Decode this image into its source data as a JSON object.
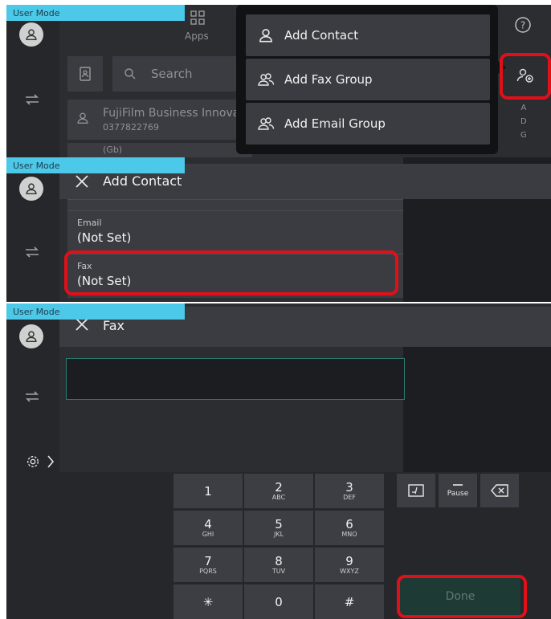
{
  "panel1": {
    "mode_label": "User Mode",
    "apps_label": "Apps",
    "search_placeholder": "Search",
    "contact_name": "FujiFilm Business Innova",
    "contact_number": "0377822769",
    "partial_row_text": "(Gb)",
    "index_letters": [
      "A",
      "D",
      "G"
    ],
    "menu": [
      {
        "icon": "person-icon",
        "label": "Add Contact"
      },
      {
        "icon": "group-icon",
        "label": "Add Fax Group"
      },
      {
        "icon": "group-icon",
        "label": "Add Email Group"
      }
    ]
  },
  "panel2": {
    "mode_label": "User Mode",
    "title": "Add Contact",
    "fields": [
      {
        "label": "Email",
        "value": "(Not Set)"
      },
      {
        "label": "Fax",
        "value": "(Not Set)"
      }
    ]
  },
  "panel3": {
    "mode_label": "User Mode",
    "title": "Fax",
    "fax_input_value": "",
    "keypad": [
      {
        "num": "1",
        "letters": ""
      },
      {
        "num": "2",
        "letters": "ABC"
      },
      {
        "num": "3",
        "letters": "DEF"
      },
      {
        "num": "4",
        "letters": "GHI"
      },
      {
        "num": "5",
        "letters": "JKL"
      },
      {
        "num": "6",
        "letters": "MNO"
      },
      {
        "num": "7",
        "letters": "PQRS"
      },
      {
        "num": "8",
        "letters": "TUV"
      },
      {
        "num": "9",
        "letters": "WXYZ"
      },
      {
        "num": "✳",
        "letters": ""
      },
      {
        "num": "0",
        "letters": ""
      },
      {
        "num": "#",
        "letters": ""
      }
    ],
    "pause_label": "Pause",
    "done_label": "Done"
  },
  "colors": {
    "mode_tab": "#4cc8e8",
    "highlight": "#e0101a",
    "done_button": "#1e3a34"
  }
}
